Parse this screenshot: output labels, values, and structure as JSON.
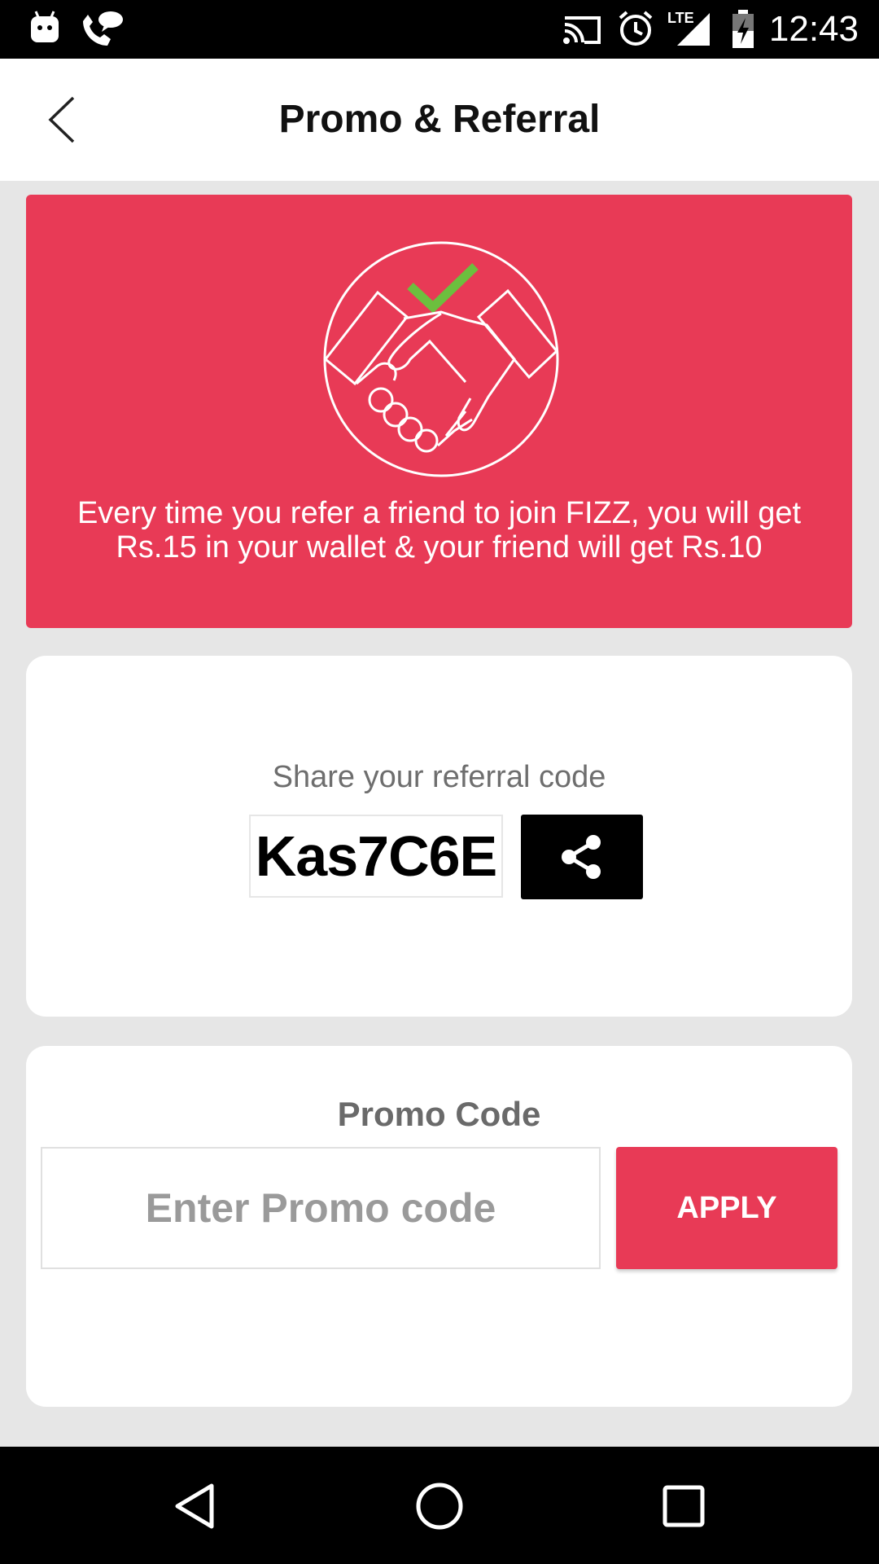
{
  "status_bar": {
    "time": "12:43",
    "network_label": "LTE",
    "icons": [
      "android-head-icon",
      "phone-chat-icon",
      "cast-icon",
      "alarm-icon",
      "lte-signal-icon",
      "battery-charging-icon"
    ]
  },
  "header": {
    "title": "Promo & Referral",
    "back_icon": "chevron-left-icon"
  },
  "hero": {
    "illustration": "handshake-check-icon",
    "text": "Every time you refer a friend to join FIZZ, you will get Rs.15 in your wallet & your friend will get Rs.10",
    "colors": {
      "background": "#e83a56",
      "check": "#6cbf3e"
    }
  },
  "referral": {
    "caption": "Share your referral code",
    "code": "Kas7C6E",
    "share_icon": "share-icon"
  },
  "promo": {
    "title": "Promo Code",
    "input_value": "",
    "input_placeholder": "Enter Promo code",
    "apply_label": "APPLY"
  },
  "nav_bar": {
    "icons": [
      "back-triangle-icon",
      "home-circle-icon",
      "recents-square-icon"
    ]
  },
  "colors": {
    "accent": "#e83a56",
    "page_bg": "#e6e6e6"
  }
}
